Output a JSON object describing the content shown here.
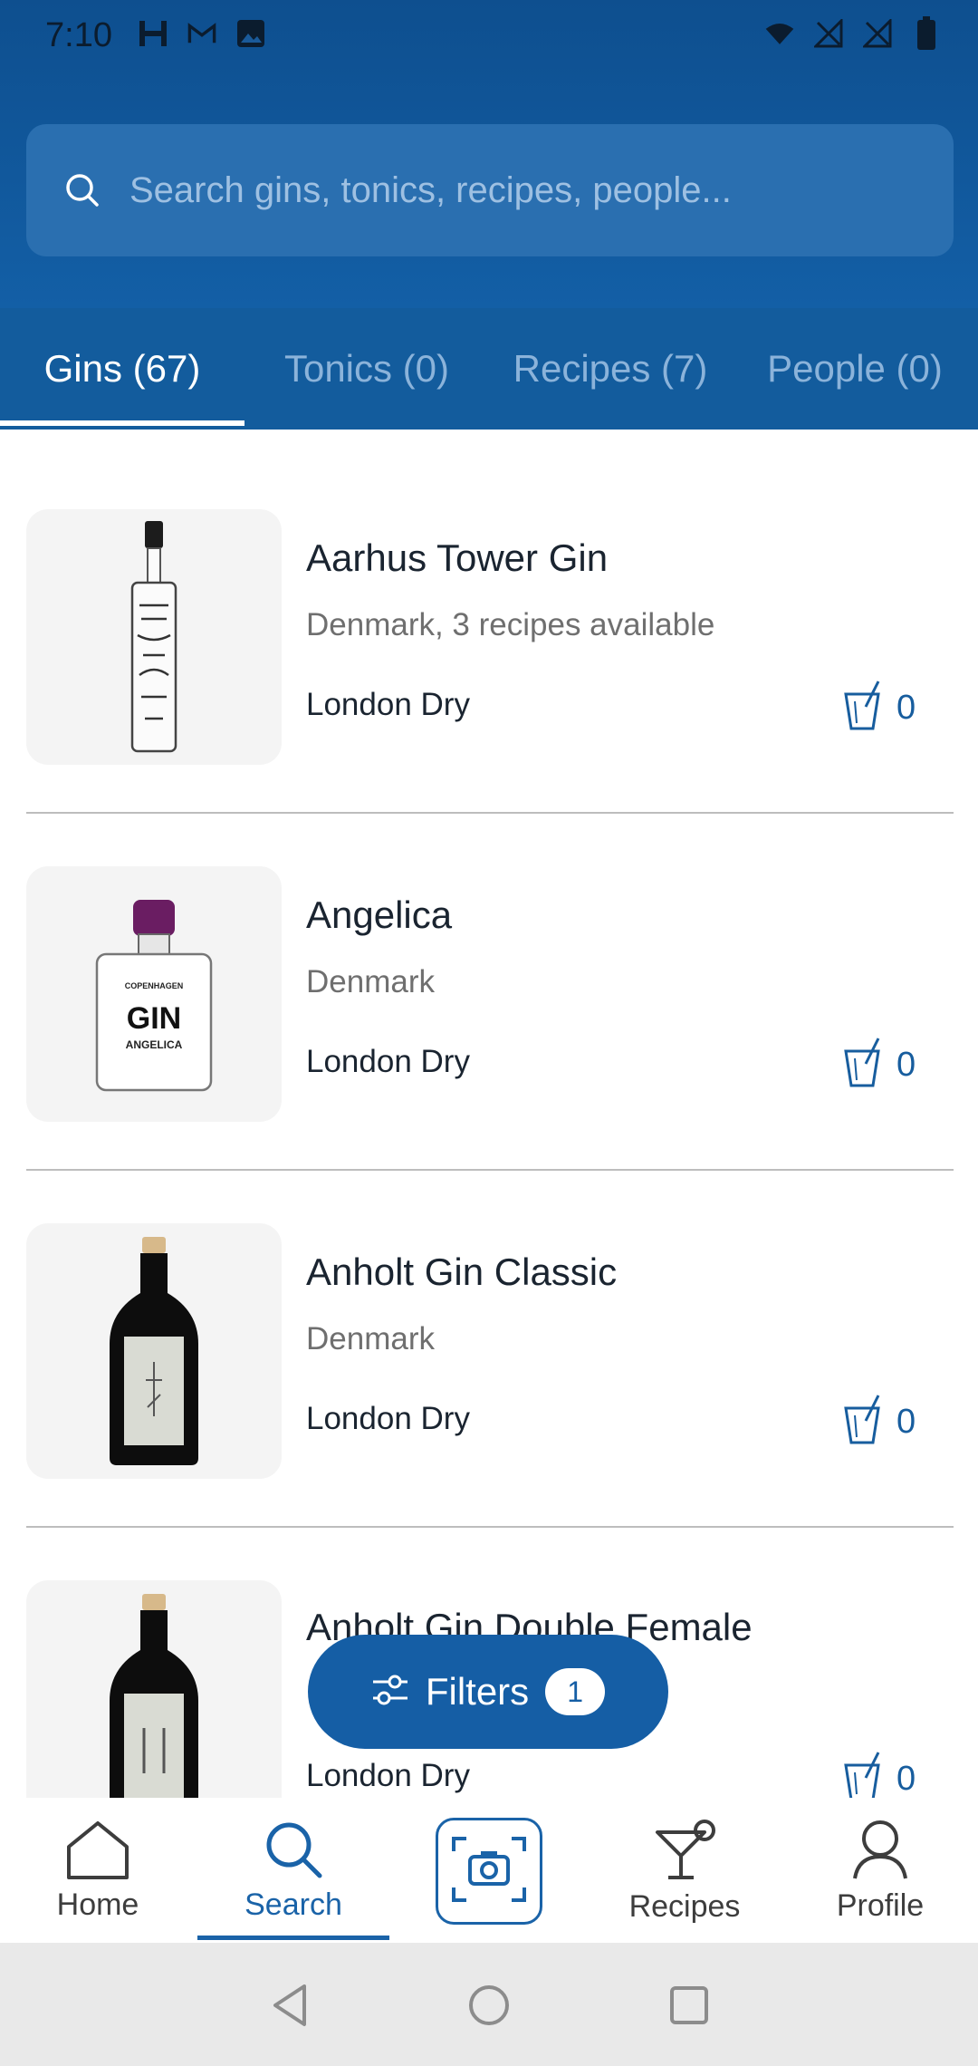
{
  "status_bar": {
    "time": "7:10",
    "left_icons": [
      "h-icon",
      "gmail-icon",
      "image-icon"
    ],
    "right_icons": [
      "wifi-icon",
      "no-sim-icon",
      "no-sim-icon",
      "battery-icon"
    ]
  },
  "search": {
    "placeholder": "Search gins, tonics, recipes, people..."
  },
  "tabs": [
    {
      "label": "Gins (67)",
      "active": true
    },
    {
      "label": "Tonics (0)",
      "active": false
    },
    {
      "label": "Recipes (7)",
      "active": false
    },
    {
      "label": "People (0)",
      "active": false
    }
  ],
  "items": [
    {
      "name": "Aarhus Tower Gin",
      "origin": "Denmark, 3 recipes available",
      "style": "London Dry",
      "count": "0"
    },
    {
      "name": "Angelica",
      "origin": "Denmark",
      "style": "London Dry",
      "count": "0",
      "label": "GIN",
      "label_sub": "ANGELICA",
      "brand": "COPENHAGEN"
    },
    {
      "name": "Anholt Gin Classic",
      "origin": "Denmark",
      "style": "London Dry",
      "count": "0"
    },
    {
      "name": "Anholt Gin Double Female",
      "origin": "",
      "style": "London Dry",
      "count": "0"
    }
  ],
  "filters": {
    "label": "Filters",
    "badge": "1"
  },
  "bottom_nav": [
    {
      "label": "Home",
      "icon": "home-icon"
    },
    {
      "label": "Search",
      "icon": "search-icon",
      "active": true
    },
    {
      "label": "",
      "icon": "camera-scan-icon"
    },
    {
      "label": "Recipes",
      "icon": "cocktail-icon"
    },
    {
      "label": "Profile",
      "icon": "person-icon"
    }
  ],
  "colors": {
    "primary": "#155ea5",
    "header": "#135c9d",
    "accent": "#175d9e"
  }
}
